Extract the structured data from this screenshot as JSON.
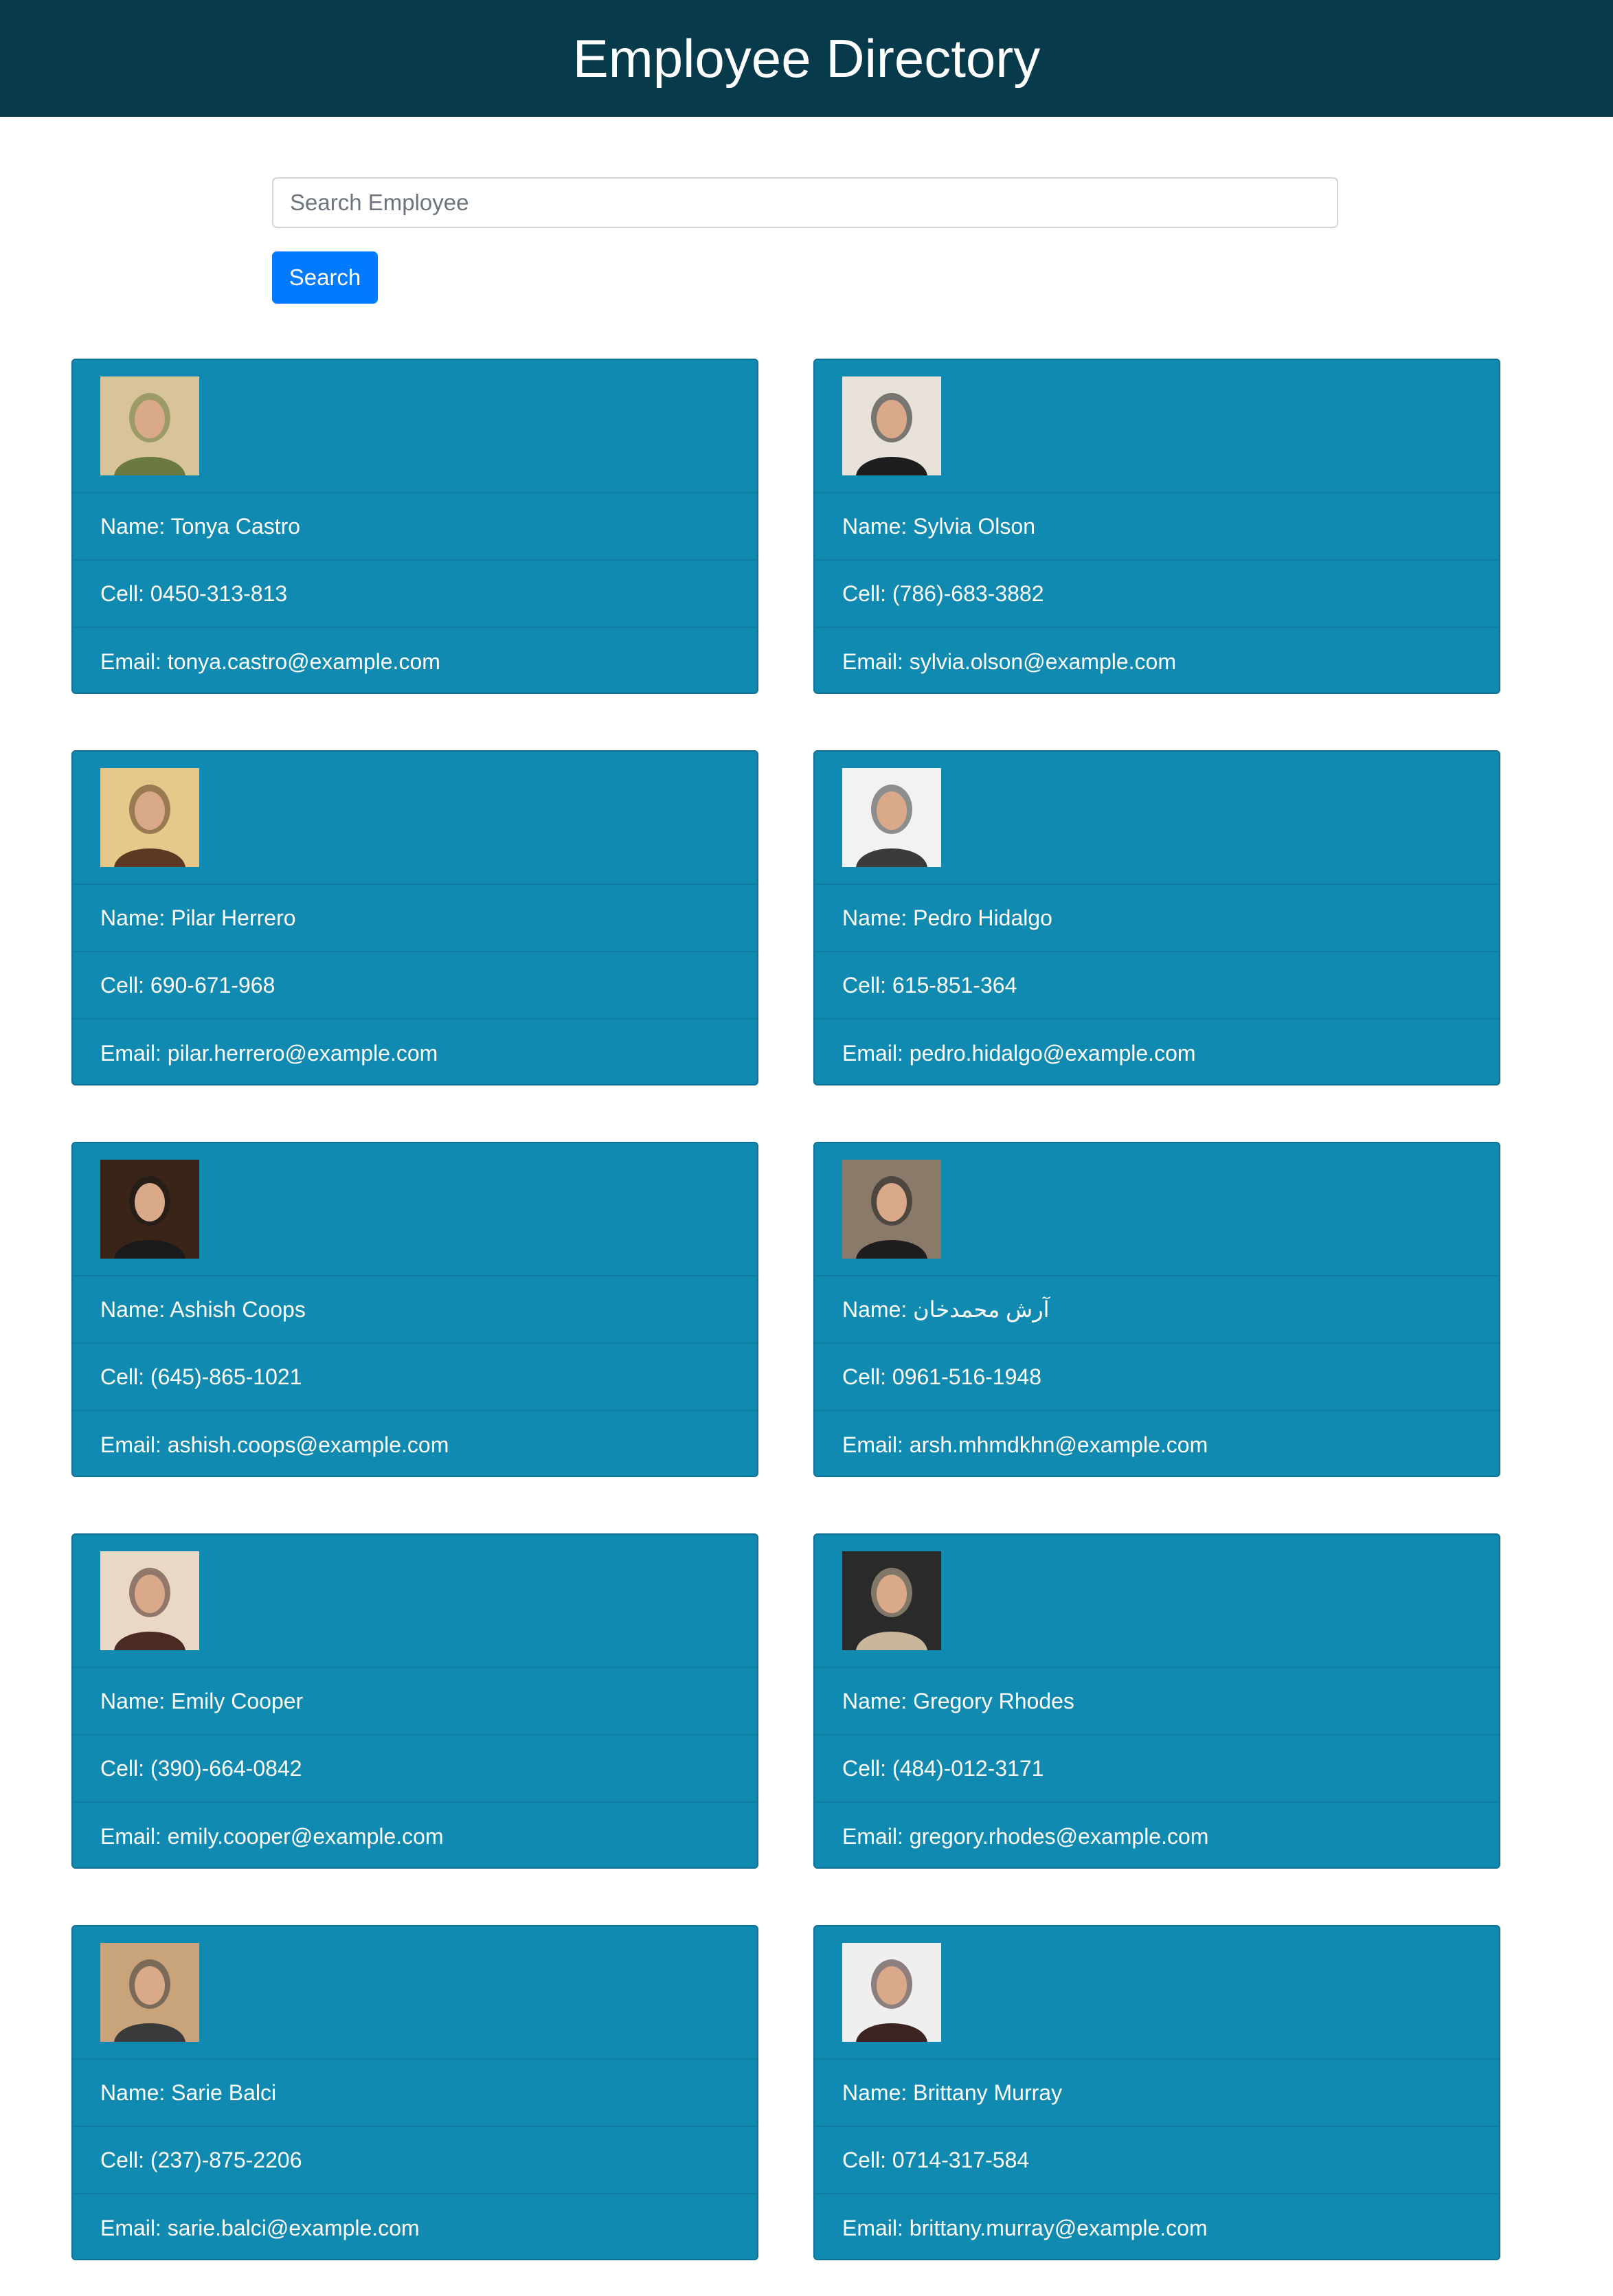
{
  "header": {
    "title": "Employee Directory"
  },
  "search": {
    "placeholder": "Search Employee",
    "value": "",
    "button_label": "Search"
  },
  "employees": [
    {
      "name": "Name: Tonya Castro",
      "cell": "Cell: 0450-313-813",
      "email": "Email: tonya.castro@example.com",
      "avatar_colors": [
        "#d8c39a",
        "#6b7a3f"
      ]
    },
    {
      "name": "Name: Sylvia Olson",
      "cell": "Cell: (786)-683-3882",
      "email": "Email: sylvia.olson@example.com",
      "avatar_colors": [
        "#e8e2da",
        "#1e1e1e"
      ]
    },
    {
      "name": "Name: Pilar Herrero",
      "cell": "Cell: 690-671-968",
      "email": "Email: pilar.herrero@example.com",
      "avatar_colors": [
        "#e6c98a",
        "#5a3a22"
      ]
    },
    {
      "name": "Name: Pedro Hidalgo",
      "cell": "Cell: 615-851-364",
      "email": "Email: pedro.hidalgo@example.com",
      "avatar_colors": [
        "#f2f2f2",
        "#3d3a3a"
      ]
    },
    {
      "name": "Name: Ashish Coops",
      "cell": "Cell: (645)-865-1021",
      "email": "Email: ashish.coops@example.com",
      "avatar_colors": [
        "#3a2418",
        "#1a1a1a"
      ]
    },
    {
      "name": "Name: آرش محمدخان",
      "cell": "Cell: 0961-516-1948",
      "email": "Email: arsh.mhmdkhn@example.com",
      "avatar_colors": [
        "#8a7a6a",
        "#1e1e1e"
      ]
    },
    {
      "name": "Name: Emily Cooper",
      "cell": "Cell: (390)-664-0842",
      "email": "Email: emily.cooper@example.com",
      "avatar_colors": [
        "#e9d8c6",
        "#4a2a22"
      ]
    },
    {
      "name": "Name: Gregory Rhodes",
      "cell": "Cell: (484)-012-3171",
      "email": "Email: gregory.rhodes@example.com",
      "avatar_colors": [
        "#2a2a2a",
        "#c9b79c"
      ]
    },
    {
      "name": "Name: Sarie Balci",
      "cell": "Cell: (237)-875-2206",
      "email": "Email: sarie.balci@example.com",
      "avatar_colors": [
        "#c9a47a",
        "#3a3a3a"
      ]
    },
    {
      "name": "Name: Brittany Murray",
      "cell": "Cell: 0714-317-584",
      "email": "Email: brittany.murray@example.com",
      "avatar_colors": [
        "#efefef",
        "#3a2320"
      ]
    }
  ]
}
